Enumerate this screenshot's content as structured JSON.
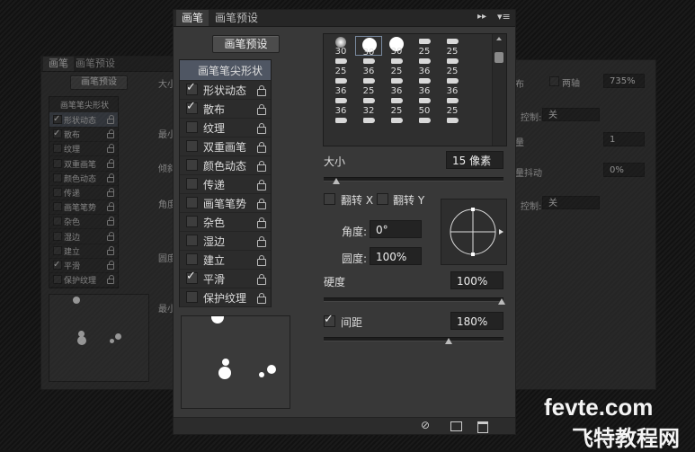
{
  "back_left": {
    "tabs": [
      "画笔",
      "画笔预设"
    ],
    "preset_button": "画笔预设",
    "list_header": "画笔笔尖形状",
    "items": [
      {
        "label": "形状动态",
        "checked": true
      },
      {
        "label": "散布",
        "checked": true
      },
      {
        "label": "纹理",
        "checked": false
      },
      {
        "label": "双重画笔",
        "checked": false
      },
      {
        "label": "颜色动态",
        "checked": false
      },
      {
        "label": "传递",
        "checked": false
      },
      {
        "label": "画笔笔势",
        "checked": false
      },
      {
        "label": "杂色",
        "checked": false
      },
      {
        "label": "湿边",
        "checked": false
      },
      {
        "label": "建立",
        "checked": false
      },
      {
        "label": "平滑",
        "checked": true
      },
      {
        "label": "保护纹理",
        "checked": false
      }
    ],
    "side_labels": [
      "大小",
      "最小",
      "倾斜",
      "角度",
      "圆度",
      "最小"
    ]
  },
  "back_right": {
    "labels": {
      "label_a": "布",
      "two_axis": "两轴",
      "value_a": "735%",
      "control_1": "控制:",
      "control_1_value": "关",
      "label_b": "量",
      "value_b": "1",
      "label_c": "量抖动",
      "value_c": "0%",
      "control_2": "控制:",
      "control_2_value": "关"
    }
  },
  "main": {
    "tabs": [
      "画笔",
      "画笔预设"
    ],
    "preset_button": "画笔预设",
    "list_header": "画笔笔尖形状",
    "items": [
      {
        "label": "形状动态",
        "checked": true
      },
      {
        "label": "散布",
        "checked": true
      },
      {
        "label": "纹理",
        "checked": false
      },
      {
        "label": "双重画笔",
        "checked": false
      },
      {
        "label": "颜色动态",
        "checked": false
      },
      {
        "label": "传递",
        "checked": false
      },
      {
        "label": "画笔笔势",
        "checked": false
      },
      {
        "label": "杂色",
        "checked": false
      },
      {
        "label": "湿边",
        "checked": false
      },
      {
        "label": "建立",
        "checked": false
      },
      {
        "label": "平滑",
        "checked": true
      },
      {
        "label": "保护纹理",
        "checked": false
      }
    ],
    "brush_sizes": [
      [
        "30",
        "30",
        "30",
        "25",
        "25"
      ],
      [
        "25",
        "36",
        "25",
        "36",
        "25"
      ],
      [
        "36",
        "25",
        "36",
        "36",
        "36"
      ],
      [
        "36",
        "32",
        "25",
        "50",
        "25"
      ],
      [
        "",
        "",
        "",
        "",
        ""
      ]
    ],
    "size_label": "大小",
    "size_value": "15 像素",
    "flip_x": "翻转 X",
    "flip_y": "翻转 Y",
    "angle_label": "角度:",
    "angle_value": "0°",
    "roundness_label": "圆度:",
    "roundness_value": "100%",
    "hardness_label": "硬度",
    "hardness_value": "100%",
    "spacing_label": "间距",
    "spacing_value": "180%",
    "spacing_checked": true
  },
  "watermark": {
    "line1": "fevte.com",
    "line2": "飞特教程网"
  }
}
